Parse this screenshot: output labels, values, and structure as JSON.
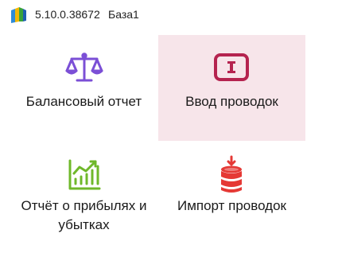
{
  "titlebar": {
    "version": "5.10.0.38672",
    "database": "База1",
    "logo_icon": "app-logo-icon"
  },
  "tiles": [
    {
      "label": "Балансовый отчет",
      "icon": "scales-icon",
      "color": "#7b4fd6"
    },
    {
      "label": "Ввод проводок",
      "icon": "entry-input-icon",
      "color": "#b5234f"
    },
    {
      "label": "Отчёт о прибылях и убытках",
      "icon": "profit-chart-icon",
      "color": "#6fb82a"
    },
    {
      "label": "Импорт проводок",
      "icon": "import-database-icon",
      "color": "#e53935"
    }
  ],
  "colors": {
    "active_tile_bg": "#f7e5ea"
  }
}
